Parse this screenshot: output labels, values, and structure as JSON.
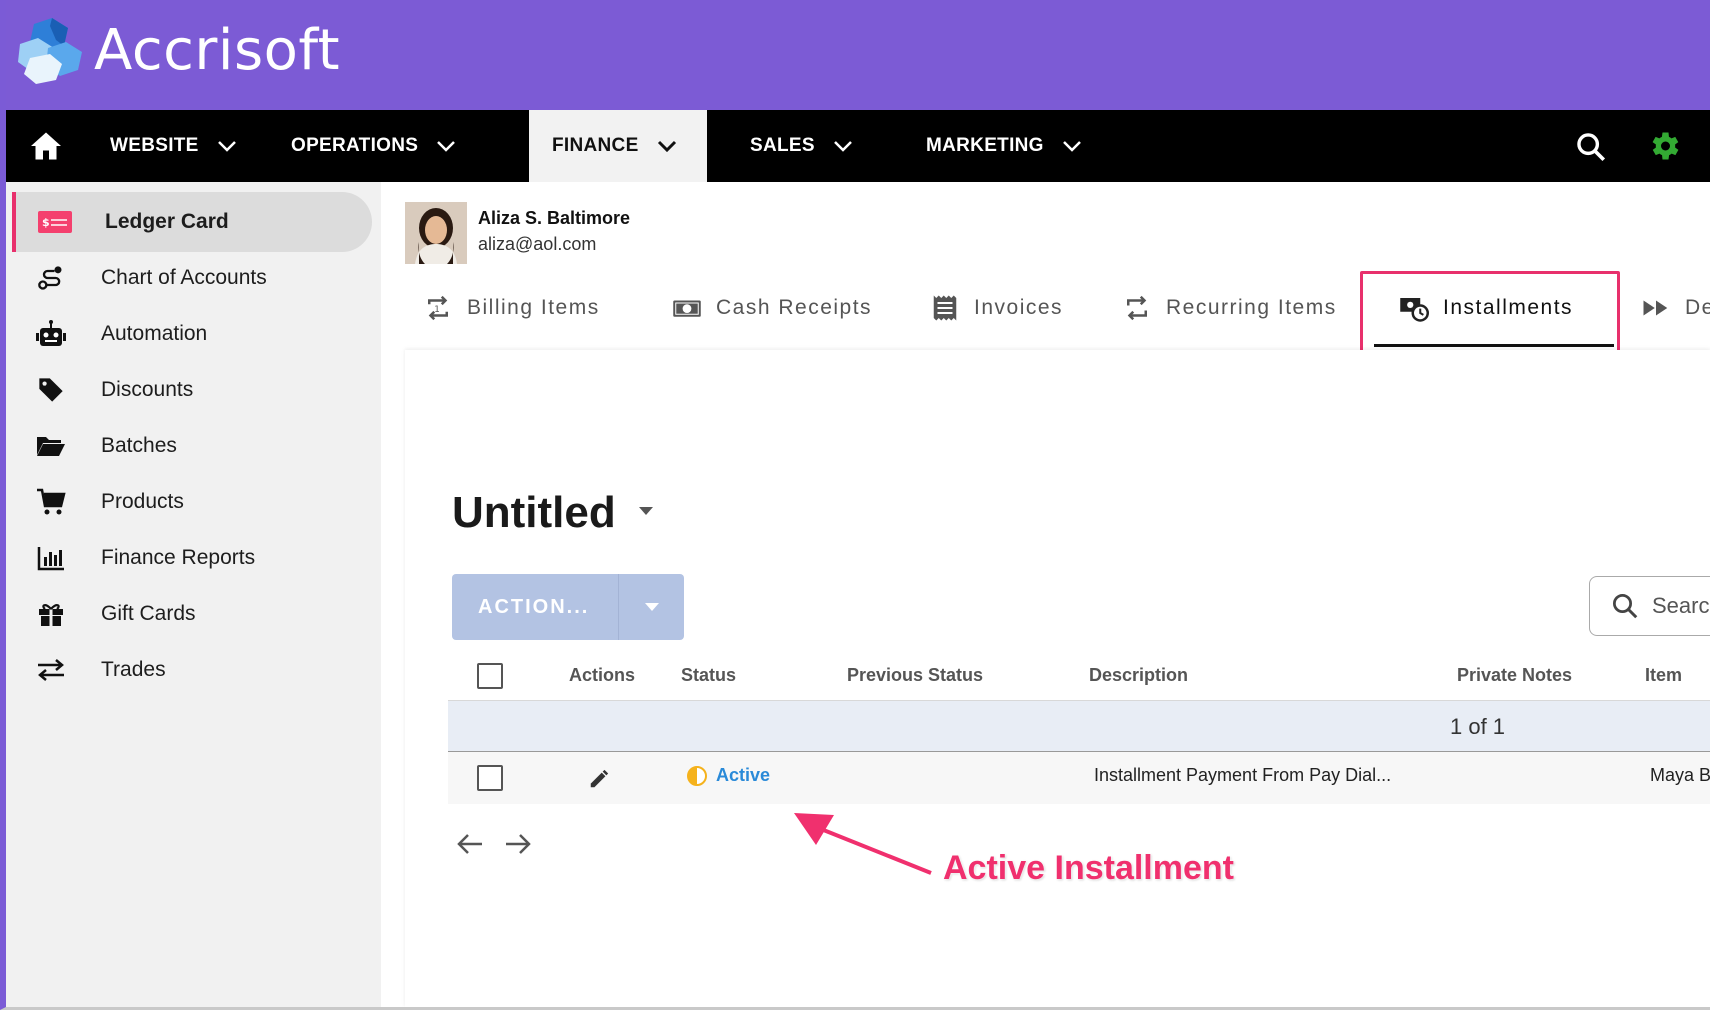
{
  "brand": {
    "name": "Accrisoft"
  },
  "nav": {
    "items": [
      {
        "label": "WEBSITE"
      },
      {
        "label": "OPERATIONS"
      },
      {
        "label": "FINANCE"
      },
      {
        "label": "SALES"
      },
      {
        "label": "MARKETING"
      }
    ],
    "active": "FINANCE",
    "icons": [
      "home-icon",
      "search-icon",
      "gear-icon"
    ],
    "gear_color": "#33aa33"
  },
  "sidebar": {
    "items": [
      {
        "label": "Ledger Card",
        "icon": "ledger-card-icon",
        "active": true
      },
      {
        "label": "Chart of Accounts",
        "icon": "route-icon"
      },
      {
        "label": "Automation",
        "icon": "robot-icon"
      },
      {
        "label": "Discounts",
        "icon": "tag-icon"
      },
      {
        "label": "Batches",
        "icon": "folder-open-icon"
      },
      {
        "label": "Products",
        "icon": "cart-icon"
      },
      {
        "label": "Finance Reports",
        "icon": "bar-chart-icon"
      },
      {
        "label": "Gift Cards",
        "icon": "gift-icon"
      },
      {
        "label": "Trades",
        "icon": "swap-icon"
      }
    ]
  },
  "user": {
    "name": "Aliza S. Baltimore",
    "email": "aliza@aol.com"
  },
  "tabs": [
    {
      "label": "Billing Items",
      "icon": "repeat-icon"
    },
    {
      "label": "Cash Receipts",
      "icon": "cash-icon"
    },
    {
      "label": "Invoices",
      "icon": "receipt-icon"
    },
    {
      "label": "Recurring Items",
      "icon": "repeat-icon"
    },
    {
      "label": "Installments",
      "icon": "installments-icon",
      "active": true
    },
    {
      "label": "De",
      "icon": "fast-forward-icon"
    }
  ],
  "page": {
    "title": "Untitled"
  },
  "action": {
    "label": "ACTION..."
  },
  "search": {
    "placeholder": "Search"
  },
  "table": {
    "columns": [
      "Actions",
      "Status",
      "Previous Status",
      "Description",
      "Private Notes",
      "Item"
    ],
    "pager": "1 of 1",
    "rows": [
      {
        "status": "Active",
        "previous_status": "",
        "description": "Installment Payment From Pay Dial...",
        "private_notes": "",
        "item": "Maya Ba"
      }
    ]
  },
  "annotation": {
    "text": "Active Installment",
    "color": "#f0306e"
  },
  "colors": {
    "brand_bar": "#7c5bd5",
    "highlight": "#e8306c",
    "status_active": "#2a8ad8",
    "action_button": "#b3c3e3"
  }
}
